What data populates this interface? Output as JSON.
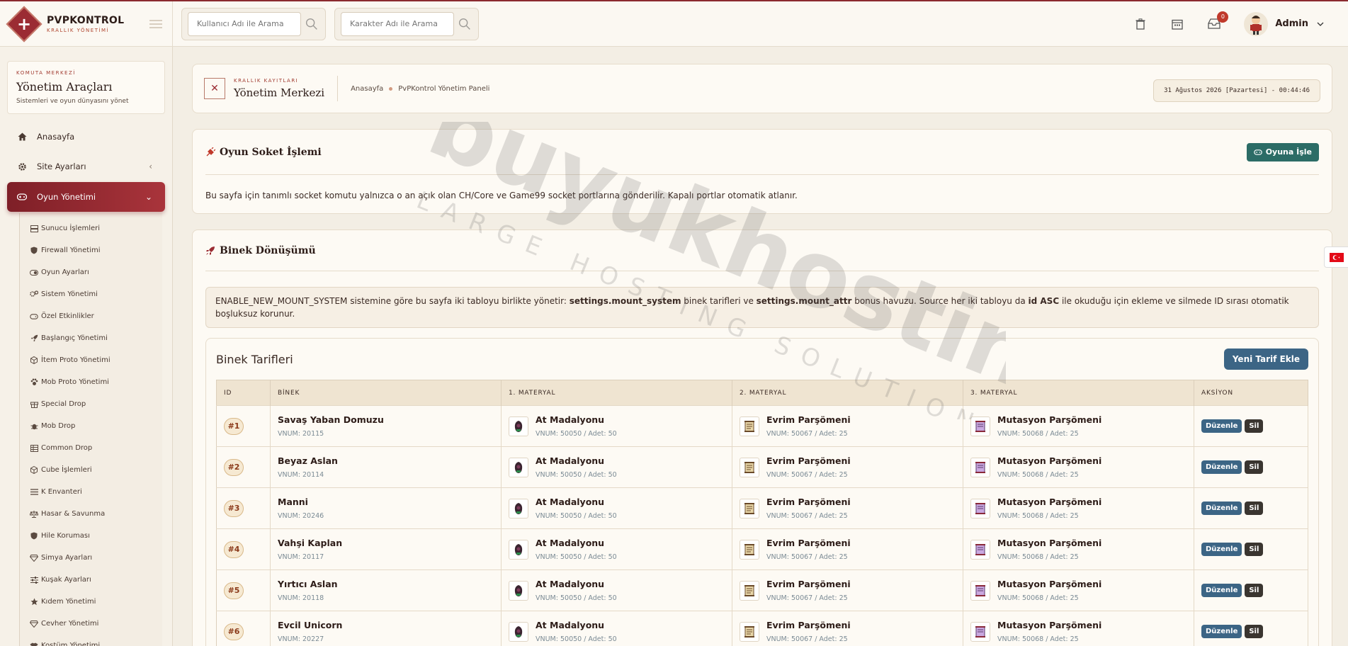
{
  "brand": {
    "name": "PVPKONTROL",
    "subtitle": "KRALLIK YÖNETİMİ"
  },
  "search": {
    "user_placeholder": "Kullanıcı Adı ile Arama",
    "char_placeholder": "Karakter Adı ile Arama"
  },
  "topbar": {
    "notification_count": "0",
    "admin_name": "Admin"
  },
  "sidebar": {
    "kicker": "KOMUTA MERKEZİ",
    "title": "Yönetim Araçları",
    "desc": "Sistemleri ve oyun dünyasını yönet",
    "items": [
      {
        "label": "Anasayfa",
        "icon": "home-icon"
      },
      {
        "label": "Site Ayarları",
        "icon": "gear-icon"
      },
      {
        "label": "Oyun Yönetimi",
        "icon": "gamepad-icon"
      }
    ],
    "sub_items": [
      {
        "label": "Sunucu İşlemleri",
        "icon": "server-icon"
      },
      {
        "label": "Firewall Yönetimi",
        "icon": "shield-icon"
      },
      {
        "label": "Oyun Ayarları",
        "icon": "toggle-icon"
      },
      {
        "label": "Sistem Yönetimi",
        "icon": "cogs-icon"
      },
      {
        "label": "Özel Etkinlikler",
        "icon": "gamepad-icon"
      },
      {
        "label": "Başlangıç Yönetimi",
        "icon": "rocket-icon"
      },
      {
        "label": "İtem Proto Yönetimi",
        "icon": "cube-icon"
      },
      {
        "label": "Mob Proto Yönetimi",
        "icon": "paw-icon"
      },
      {
        "label": "Special Drop",
        "icon": "gift-icon"
      },
      {
        "label": "Mob Drop",
        "icon": "bug-icon"
      },
      {
        "label": "Common Drop",
        "icon": "table-icon"
      },
      {
        "label": "Cube İşlemleri",
        "icon": "cube-icon"
      },
      {
        "label": "K Envanteri",
        "icon": "list-icon"
      },
      {
        "label": "Hasar & Savunma",
        "icon": "scale-icon"
      },
      {
        "label": "Hile Koruması",
        "icon": "shield-icon"
      },
      {
        "label": "Simya Ayarları",
        "icon": "gem-icon"
      },
      {
        "label": "Kuşak Ayarları",
        "icon": "sliders-icon"
      },
      {
        "label": "Kıdem Yönetimi",
        "icon": "star-icon"
      },
      {
        "label": "Cevher Yönetimi",
        "icon": "gem-icon"
      },
      {
        "label": "Kostüm Yönetimi",
        "icon": "shirt-icon"
      }
    ]
  },
  "page": {
    "kicker": "KRALLIK KAYITLARI",
    "title": "Yönetim Merkezi",
    "breadcrumb_home": "Anasayfa",
    "breadcrumb_current": "PvPKontrol Yönetim Paneli",
    "datetime": "31 Ağustos 2026 [Pazartesi] - 00:44:46"
  },
  "socket": {
    "title": "Oyun Soket İşlemi",
    "button": "Oyuna İşle",
    "text": "Bu sayfa için tanımlı socket komutu yalnızca o an açık olan CH/Core ve Game99 socket portlarına gönderilir. Kapalı portlar otomatik atlanır."
  },
  "mount": {
    "title": "Binek Dönüşümü",
    "info": {
      "p1": "ENABLE_NEW_MOUNT_SYSTEM sistemine göre bu sayfa iki tabloyu birlikte yönetir: ",
      "b1": "settings.mount_system",
      "p2": " binek tarifleri ve ",
      "b2": "settings.mount_attr",
      "p3": " bonus havuzu. Source her iki tabloyu da ",
      "b3": "id ASC",
      "p4": " ile okuduğu için ekleme ve silmede ID sırası otomatik boşluksuz korunur."
    },
    "table_title": "Binek Tarifleri",
    "new_button": "Yeni Tarif Ekle",
    "headers": {
      "id": "ID",
      "binek": "BİNEK",
      "m1": "1. MATERYAL",
      "m2": "2. MATERYAL",
      "m3": "3. MATERYAL",
      "action": "AKSİYON"
    },
    "edit_label": "Düzenle",
    "delete_label": "Sil",
    "rows": [
      {
        "id": "#1",
        "name": "Savaş Yaban Domuzu",
        "vnum": "VNUM: 20115",
        "m1": "At Madalyonu",
        "m1v": "VNUM: 50050 / Adet: 50",
        "m2": "Evrim Parşömeni",
        "m2v": "VNUM: 50067 / Adet: 25",
        "m3": "Mutasyon Parşömeni",
        "m3v": "VNUM: 50068 / Adet: 25"
      },
      {
        "id": "#2",
        "name": "Beyaz Aslan",
        "vnum": "VNUM: 20114",
        "m1": "At Madalyonu",
        "m1v": "VNUM: 50050 / Adet: 50",
        "m2": "Evrim Parşömeni",
        "m2v": "VNUM: 50067 / Adet: 25",
        "m3": "Mutasyon Parşömeni",
        "m3v": "VNUM: 50068 / Adet: 25"
      },
      {
        "id": "#3",
        "name": "Manni",
        "vnum": "VNUM: 20246",
        "m1": "At Madalyonu",
        "m1v": "VNUM: 50050 / Adet: 50",
        "m2": "Evrim Parşömeni",
        "m2v": "VNUM: 50067 / Adet: 25",
        "m3": "Mutasyon Parşömeni",
        "m3v": "VNUM: 50068 / Adet: 25"
      },
      {
        "id": "#4",
        "name": "Vahşi Kaplan",
        "vnum": "VNUM: 20117",
        "m1": "At Madalyonu",
        "m1v": "VNUM: 50050 / Adet: 50",
        "m2": "Evrim Parşömeni",
        "m2v": "VNUM: 50067 / Adet: 25",
        "m3": "Mutasyon Parşömeni",
        "m3v": "VNUM: 50068 / Adet: 25"
      },
      {
        "id": "#5",
        "name": "Yırtıcı Aslan",
        "vnum": "VNUM: 20118",
        "m1": "At Madalyonu",
        "m1v": "VNUM: 50050 / Adet: 50",
        "m2": "Evrim Parşömeni",
        "m2v": "VNUM: 50067 / Adet: 25",
        "m3": "Mutasyon Parşömeni",
        "m3v": "VNUM: 50068 / Adet: 25"
      },
      {
        "id": "#6",
        "name": "Evcil Unicorn",
        "vnum": "VNUM: 20227",
        "m1": "At Madalyonu",
        "m1v": "VNUM: 50050 / Adet: 50",
        "m2": "Evrim Parşömeni",
        "m2v": "VNUM: 50067 / Adet: 25",
        "m3": "Mutasyon Parşömeni",
        "m3v": "VNUM: 50068 / Adet: 25"
      }
    ]
  },
  "watermark": {
    "line1": "buyukhosting",
    "line2": "LARGE HOSTING SOLUTIONS"
  },
  "colors": {
    "brand": "#9b2c33",
    "teal": "#2c6c66",
    "blue": "#3c6585"
  }
}
